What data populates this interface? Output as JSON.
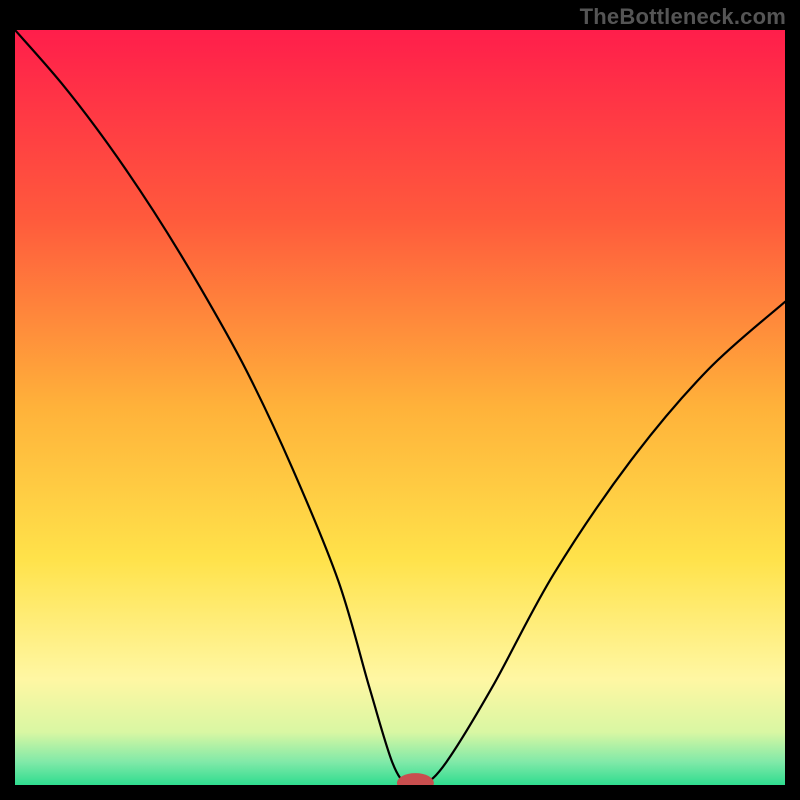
{
  "watermark": "TheBottleneck.com",
  "chart_data": {
    "type": "line",
    "title": "",
    "xlabel": "",
    "ylabel": "",
    "xlim": [
      0,
      100
    ],
    "ylim": [
      0,
      100
    ],
    "background_gradient": {
      "stops": [
        {
          "offset": 0,
          "color": "#ff1e4b"
        },
        {
          "offset": 25,
          "color": "#ff5a3c"
        },
        {
          "offset": 50,
          "color": "#ffb23a"
        },
        {
          "offset": 70,
          "color": "#ffe24a"
        },
        {
          "offset": 86,
          "color": "#fff7a3"
        },
        {
          "offset": 93,
          "color": "#d9f7a3"
        },
        {
          "offset": 97,
          "color": "#7fe9a8"
        },
        {
          "offset": 100,
          "color": "#2fdc8f"
        }
      ]
    },
    "series": [
      {
        "name": "bottleneck-curve",
        "x": [
          0,
          6,
          12,
          18,
          24,
          30,
          36,
          42,
          46,
          49,
          51,
          53,
          56,
          62,
          70,
          80,
          90,
          100
        ],
        "y": [
          100,
          93,
          85,
          76,
          66,
          55,
          42,
          27,
          13,
          3,
          0,
          0,
          3,
          13,
          28,
          43,
          55,
          64
        ]
      }
    ],
    "marker": {
      "x": 52,
      "y": 0,
      "rx": 2.4,
      "ry": 1.3,
      "color": "#c94f4f"
    }
  }
}
